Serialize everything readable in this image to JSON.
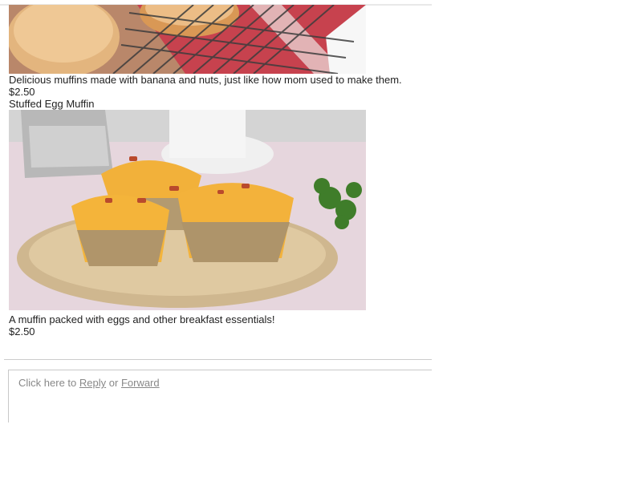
{
  "products": [
    {
      "image_alt": "banana nut muffins on cooling rack",
      "description": "Delicious muffins made with banana and nuts, just like how mom used to make them.",
      "price": "$2.50"
    },
    {
      "name": "Stuffed Egg Muffin",
      "image_alt": "stuffed egg muffins on a plate",
      "description": "A muffin packed with eggs and other breakfast essentials!",
      "price": "$2.50"
    }
  ],
  "reply": {
    "prefix": "Click here to",
    "reply_link": "Reply",
    "middle": "or",
    "forward_link": "Forward"
  }
}
